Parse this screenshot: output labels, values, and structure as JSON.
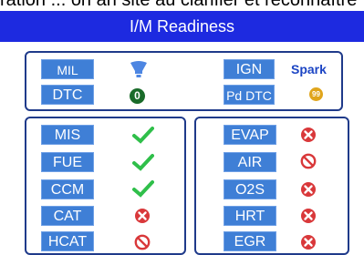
{
  "caption_fragment": "ration ... on an site au clarifier et reconnaître",
  "header": {
    "title": "I/M Readiness"
  },
  "top_panel": {
    "mil_label": "MIL",
    "ign_label": "IGN",
    "ign_value": "Spark",
    "dtc_label": "DTC",
    "dtc_count": "0",
    "pd_dtc_label": "Pd DTC",
    "pd_dtc_count": "99",
    "mil_icon": "mil-lamp-icon"
  },
  "left_monitors": [
    {
      "label": "MIS",
      "status": "complete"
    },
    {
      "label": "FUE",
      "status": "complete"
    },
    {
      "label": "CCM",
      "status": "complete"
    },
    {
      "label": "CAT",
      "status": "incomplete"
    },
    {
      "label": "HCAT",
      "status": "not-supported"
    }
  ],
  "right_monitors": [
    {
      "label": "EVAP",
      "status": "incomplete"
    },
    {
      "label": "AIR",
      "status": "not-supported"
    },
    {
      "label": "O2S",
      "status": "incomplete"
    },
    {
      "label": "HRT",
      "status": "incomplete"
    },
    {
      "label": "EGR",
      "status": "incomplete"
    }
  ],
  "colors": {
    "header": "#1d2ae0",
    "tag": "#3f7fd6",
    "check": "#2fbf4a",
    "x": "#d9383a",
    "dtc_badge": "#1a6b2a",
    "pd_badge": "#e0a51c"
  }
}
